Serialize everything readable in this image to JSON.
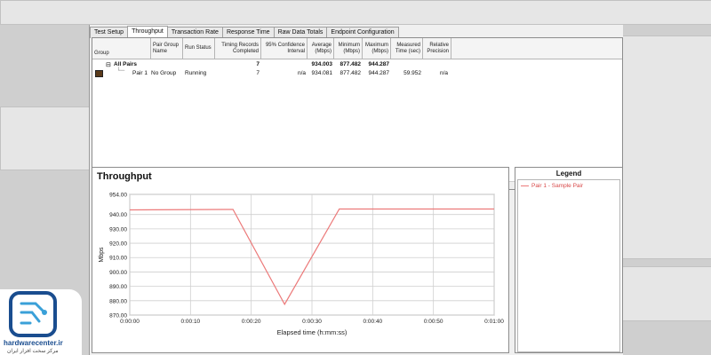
{
  "tabs": [
    {
      "label": "Test Setup",
      "active": false
    },
    {
      "label": "Throughput",
      "active": true
    },
    {
      "label": "Transaction Rate",
      "active": false
    },
    {
      "label": "Response Time",
      "active": false
    },
    {
      "label": "Raw Data Totals",
      "active": false
    },
    {
      "label": "Endpoint Configuration",
      "active": false
    }
  ],
  "table": {
    "headers": {
      "group": "Group",
      "pair_group_name": "Pair Group\nName",
      "run_status": "Run Status",
      "timing_records": "Timing Records\nCompleted",
      "confidence": "95% Confidence\nInterval",
      "average": "Average\n(Mbps)",
      "minimum": "Minimum\n(Mbps)",
      "maximum": "Maximum\n(Mbps)",
      "measured_time": "Measured\nTime (sec)",
      "relative_precision": "Relative\nPrecision"
    },
    "summary": {
      "toggle": "⊟",
      "name": "All Pairs",
      "timing_records": "7",
      "average": "934.003",
      "minimum": "877.482",
      "maximum": "944.287"
    },
    "row": {
      "pair": "Pair 1",
      "pair_group": "No Group",
      "run_status": "Running",
      "timing_records": "7",
      "confidence": "n/a",
      "average": "934.081",
      "minimum": "877.482",
      "maximum": "944.287",
      "measured_time": "59.952",
      "relative_precision": "n/a"
    }
  },
  "legend": {
    "title": "Legend",
    "items": [
      {
        "label": "Pair 1 - Sample Pair",
        "color": "#ec7a7a"
      }
    ]
  },
  "logo": {
    "name": "hardwarecenter.ir",
    "sub": "مرکز سخت افزار ایران"
  },
  "chart_data": {
    "type": "line",
    "title": "Throughput",
    "xlabel": "Elapsed time (h:mm:ss)",
    "ylabel": "Mbps",
    "xlim": [
      0,
      60
    ],
    "ylim": [
      870,
      954
    ],
    "yticks": [
      870,
      880,
      890,
      900,
      910,
      920,
      930,
      940,
      954
    ],
    "ytick_labels": [
      "870.00",
      "880.00",
      "890.00",
      "900.00",
      "910.00",
      "920.00",
      "930.00",
      "940.00",
      "954.00"
    ],
    "xticks": [
      0,
      10,
      20,
      30,
      40,
      50,
      60
    ],
    "xtick_labels": [
      "0:00:00",
      "0:00:10",
      "0:00:20",
      "0:00:30",
      "0:00:40",
      "0:00:50",
      "0:01:00"
    ],
    "grid": true,
    "series": [
      {
        "name": "Pair 1 - Sample Pair",
        "color": "#ec7a7a",
        "x": [
          0,
          17,
          25.5,
          34.5,
          60
        ],
        "y": [
          943.2,
          943.5,
          877.5,
          943.8,
          943.8
        ]
      }
    ]
  }
}
